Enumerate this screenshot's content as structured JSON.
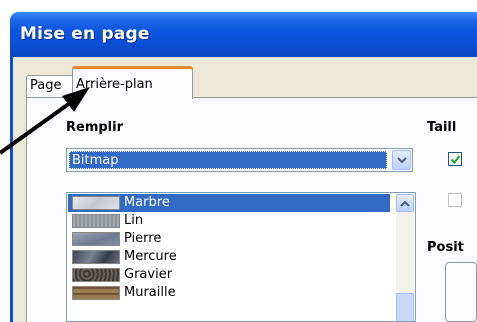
{
  "window": {
    "title": "Mise en page"
  },
  "tabs": [
    {
      "label": "Page"
    },
    {
      "label": "Arrière-plan"
    }
  ],
  "fill": {
    "label": "Remplir",
    "type_value": "Bitmap",
    "items": [
      {
        "label": "Marbre",
        "selected": true,
        "swatch": "#d4d6da"
      },
      {
        "label": "Lin",
        "selected": false,
        "swatch": "#9a9fa4"
      },
      {
        "label": "Pierre",
        "selected": false,
        "swatch": "#7f8a9e"
      },
      {
        "label": "Mercure",
        "selected": false,
        "swatch": "#4c5360"
      },
      {
        "label": "Gravier",
        "selected": false,
        "swatch": "#58504a"
      },
      {
        "label": "Muraille",
        "selected": false,
        "swatch": "#8a6a44"
      }
    ]
  },
  "size": {
    "label": "Taill"
  },
  "position": {
    "label": "Posit"
  },
  "colors": {
    "titlebar": "#0b4fd4",
    "selection": "#316ac5",
    "tab_highlight": "#e68b2c"
  }
}
